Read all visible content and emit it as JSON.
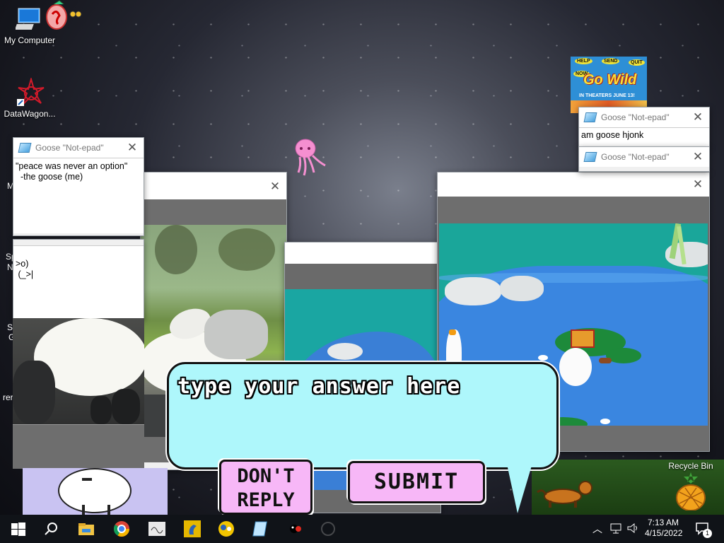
{
  "desktop": {
    "icons": [
      {
        "label": "My Computer"
      },
      {
        "label": "DataWagon..."
      },
      {
        "label": "Recycle Bin"
      }
    ],
    "poster": {
      "line1": "HELP",
      "line2": "SEND",
      "line3": "Go Wild",
      "line4": "IN THEATERS JUNE 13!",
      "line5": "NOW",
      "line6": "QUIT"
    },
    "edge_fragments": [
      "M",
      "Sp",
      "N",
      "S",
      "G",
      "rer"
    ]
  },
  "notepads": {
    "app_title": "Goose \"Not-epad\"",
    "quote": {
      "text": "\"peace was never an option\"\n  -the goose (me)"
    },
    "ascii": {
      "text": ">o)\n (_>|"
    },
    "hjonk": {
      "text": "am goose hjonk"
    }
  },
  "bubble": {
    "prompt": "type your answer here",
    "dont_reply": "DON'T\nREPLY",
    "submit": "SUBMIT"
  },
  "taskbar": {
    "time": "7:13 AM",
    "date": "4/15/2022",
    "notification_count": "1"
  },
  "colors": {
    "bubble_fill": "#aef7fb",
    "pink_button": "#f7b7f7",
    "water": "#3a7fd6",
    "teal": "#1aa6a2"
  }
}
